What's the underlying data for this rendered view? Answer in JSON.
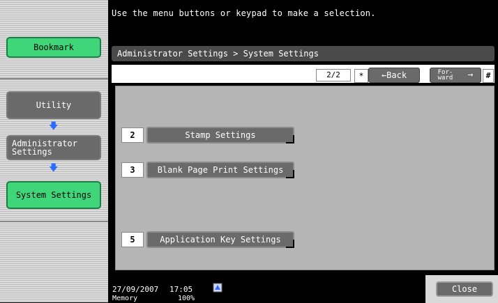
{
  "header": {
    "message": "Use the menu buttons or keypad to make a selection."
  },
  "sidebar": {
    "bookmark": "Bookmark",
    "utility": "Utility",
    "administrator": "Administrator\nSettings",
    "system_settings": "System Settings"
  },
  "breadcrumb": "Administrator Settings > System Settings",
  "nav": {
    "page": "2/2",
    "star": "*",
    "back_label": "←Back",
    "forward_label": "For-\nward",
    "forward_arrow": "→",
    "hash": "#"
  },
  "items": [
    {
      "num": "2",
      "label": "Stamp Settings"
    },
    {
      "num": "3",
      "label": "Blank Page Print Settings"
    },
    {
      "num": "5",
      "label": "Application Key Settings"
    }
  ],
  "footer": {
    "date": "27/09/2007",
    "time": "17:05",
    "memory_label": "Memory",
    "memory_pct": "100%",
    "close_label": "Close"
  },
  "colors": {
    "accent_green": "#3fd67a",
    "button_gray": "#6a6a6a",
    "arrow_blue": "#2a6cff"
  },
  "icons": {
    "network": "network-status-icon",
    "arrow_down": "arrow-down-icon"
  }
}
